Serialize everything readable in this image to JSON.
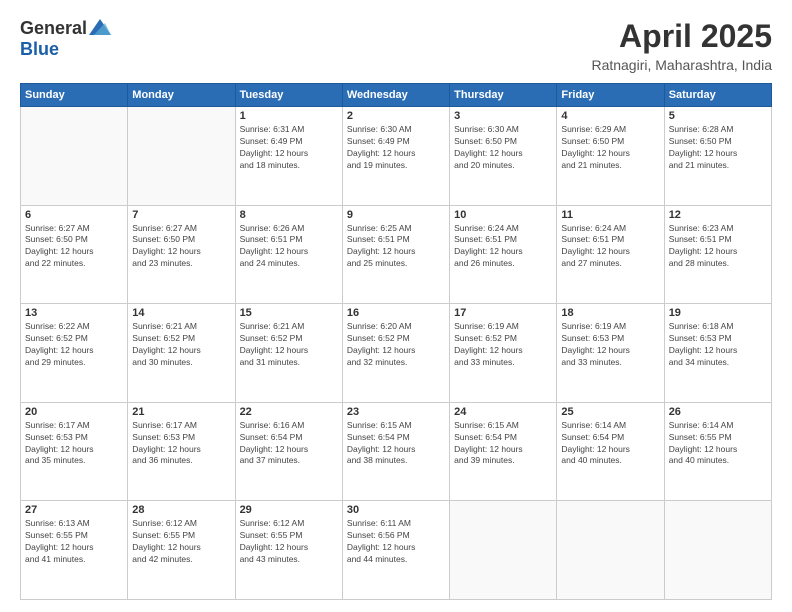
{
  "header": {
    "logo_general": "General",
    "logo_blue": "Blue",
    "title": "April 2025",
    "location": "Ratnagiri, Maharashtra, India"
  },
  "days_of_week": [
    "Sunday",
    "Monday",
    "Tuesday",
    "Wednesday",
    "Thursday",
    "Friday",
    "Saturday"
  ],
  "weeks": [
    [
      {
        "day": "",
        "details": []
      },
      {
        "day": "",
        "details": []
      },
      {
        "day": "1",
        "details": [
          "Sunrise: 6:31 AM",
          "Sunset: 6:49 PM",
          "Daylight: 12 hours",
          "and 18 minutes."
        ]
      },
      {
        "day": "2",
        "details": [
          "Sunrise: 6:30 AM",
          "Sunset: 6:49 PM",
          "Daylight: 12 hours",
          "and 19 minutes."
        ]
      },
      {
        "day": "3",
        "details": [
          "Sunrise: 6:30 AM",
          "Sunset: 6:50 PM",
          "Daylight: 12 hours",
          "and 20 minutes."
        ]
      },
      {
        "day": "4",
        "details": [
          "Sunrise: 6:29 AM",
          "Sunset: 6:50 PM",
          "Daylight: 12 hours",
          "and 21 minutes."
        ]
      },
      {
        "day": "5",
        "details": [
          "Sunrise: 6:28 AM",
          "Sunset: 6:50 PM",
          "Daylight: 12 hours",
          "and 21 minutes."
        ]
      }
    ],
    [
      {
        "day": "6",
        "details": [
          "Sunrise: 6:27 AM",
          "Sunset: 6:50 PM",
          "Daylight: 12 hours",
          "and 22 minutes."
        ]
      },
      {
        "day": "7",
        "details": [
          "Sunrise: 6:27 AM",
          "Sunset: 6:50 PM",
          "Daylight: 12 hours",
          "and 23 minutes."
        ]
      },
      {
        "day": "8",
        "details": [
          "Sunrise: 6:26 AM",
          "Sunset: 6:51 PM",
          "Daylight: 12 hours",
          "and 24 minutes."
        ]
      },
      {
        "day": "9",
        "details": [
          "Sunrise: 6:25 AM",
          "Sunset: 6:51 PM",
          "Daylight: 12 hours",
          "and 25 minutes."
        ]
      },
      {
        "day": "10",
        "details": [
          "Sunrise: 6:24 AM",
          "Sunset: 6:51 PM",
          "Daylight: 12 hours",
          "and 26 minutes."
        ]
      },
      {
        "day": "11",
        "details": [
          "Sunrise: 6:24 AM",
          "Sunset: 6:51 PM",
          "Daylight: 12 hours",
          "and 27 minutes."
        ]
      },
      {
        "day": "12",
        "details": [
          "Sunrise: 6:23 AM",
          "Sunset: 6:51 PM",
          "Daylight: 12 hours",
          "and 28 minutes."
        ]
      }
    ],
    [
      {
        "day": "13",
        "details": [
          "Sunrise: 6:22 AM",
          "Sunset: 6:52 PM",
          "Daylight: 12 hours",
          "and 29 minutes."
        ]
      },
      {
        "day": "14",
        "details": [
          "Sunrise: 6:21 AM",
          "Sunset: 6:52 PM",
          "Daylight: 12 hours",
          "and 30 minutes."
        ]
      },
      {
        "day": "15",
        "details": [
          "Sunrise: 6:21 AM",
          "Sunset: 6:52 PM",
          "Daylight: 12 hours",
          "and 31 minutes."
        ]
      },
      {
        "day": "16",
        "details": [
          "Sunrise: 6:20 AM",
          "Sunset: 6:52 PM",
          "Daylight: 12 hours",
          "and 32 minutes."
        ]
      },
      {
        "day": "17",
        "details": [
          "Sunrise: 6:19 AM",
          "Sunset: 6:52 PM",
          "Daylight: 12 hours",
          "and 33 minutes."
        ]
      },
      {
        "day": "18",
        "details": [
          "Sunrise: 6:19 AM",
          "Sunset: 6:53 PM",
          "Daylight: 12 hours",
          "and 33 minutes."
        ]
      },
      {
        "day": "19",
        "details": [
          "Sunrise: 6:18 AM",
          "Sunset: 6:53 PM",
          "Daylight: 12 hours",
          "and 34 minutes."
        ]
      }
    ],
    [
      {
        "day": "20",
        "details": [
          "Sunrise: 6:17 AM",
          "Sunset: 6:53 PM",
          "Daylight: 12 hours",
          "and 35 minutes."
        ]
      },
      {
        "day": "21",
        "details": [
          "Sunrise: 6:17 AM",
          "Sunset: 6:53 PM",
          "Daylight: 12 hours",
          "and 36 minutes."
        ]
      },
      {
        "day": "22",
        "details": [
          "Sunrise: 6:16 AM",
          "Sunset: 6:54 PM",
          "Daylight: 12 hours",
          "and 37 minutes."
        ]
      },
      {
        "day": "23",
        "details": [
          "Sunrise: 6:15 AM",
          "Sunset: 6:54 PM",
          "Daylight: 12 hours",
          "and 38 minutes."
        ]
      },
      {
        "day": "24",
        "details": [
          "Sunrise: 6:15 AM",
          "Sunset: 6:54 PM",
          "Daylight: 12 hours",
          "and 39 minutes."
        ]
      },
      {
        "day": "25",
        "details": [
          "Sunrise: 6:14 AM",
          "Sunset: 6:54 PM",
          "Daylight: 12 hours",
          "and 40 minutes."
        ]
      },
      {
        "day": "26",
        "details": [
          "Sunrise: 6:14 AM",
          "Sunset: 6:55 PM",
          "Daylight: 12 hours",
          "and 40 minutes."
        ]
      }
    ],
    [
      {
        "day": "27",
        "details": [
          "Sunrise: 6:13 AM",
          "Sunset: 6:55 PM",
          "Daylight: 12 hours",
          "and 41 minutes."
        ]
      },
      {
        "day": "28",
        "details": [
          "Sunrise: 6:12 AM",
          "Sunset: 6:55 PM",
          "Daylight: 12 hours",
          "and 42 minutes."
        ]
      },
      {
        "day": "29",
        "details": [
          "Sunrise: 6:12 AM",
          "Sunset: 6:55 PM",
          "Daylight: 12 hours",
          "and 43 minutes."
        ]
      },
      {
        "day": "30",
        "details": [
          "Sunrise: 6:11 AM",
          "Sunset: 6:56 PM",
          "Daylight: 12 hours",
          "and 44 minutes."
        ]
      },
      {
        "day": "",
        "details": []
      },
      {
        "day": "",
        "details": []
      },
      {
        "day": "",
        "details": []
      }
    ]
  ]
}
